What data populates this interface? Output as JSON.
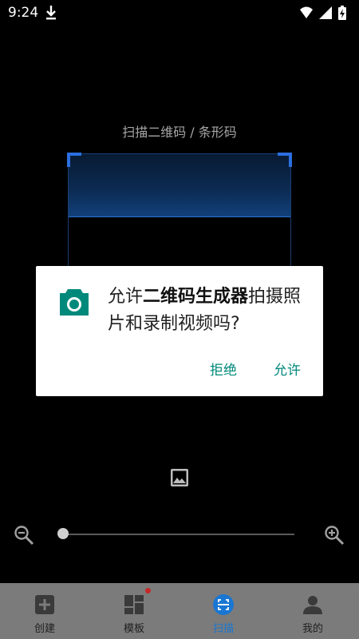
{
  "status_bar": {
    "time": "9:24"
  },
  "scanner": {
    "hint": "扫描二维码 / 条形码"
  },
  "dialog": {
    "prefix": "允许",
    "app_name": "二维码生成器",
    "suffix": "拍摄照片和录制视频吗?",
    "deny_label": "拒绝",
    "allow_label": "允许"
  },
  "bottom_nav": {
    "items": [
      {
        "label": "创建",
        "icon": "add-box-icon"
      },
      {
        "label": "模板",
        "icon": "dashboard-icon"
      },
      {
        "label": "扫描",
        "icon": "scan-icon"
      },
      {
        "label": "我的",
        "icon": "person-icon"
      }
    ],
    "active_index": 2
  },
  "colors": {
    "dialog_accent": "#00897b",
    "nav_active": "#1976d2",
    "badge": "#c62828"
  }
}
